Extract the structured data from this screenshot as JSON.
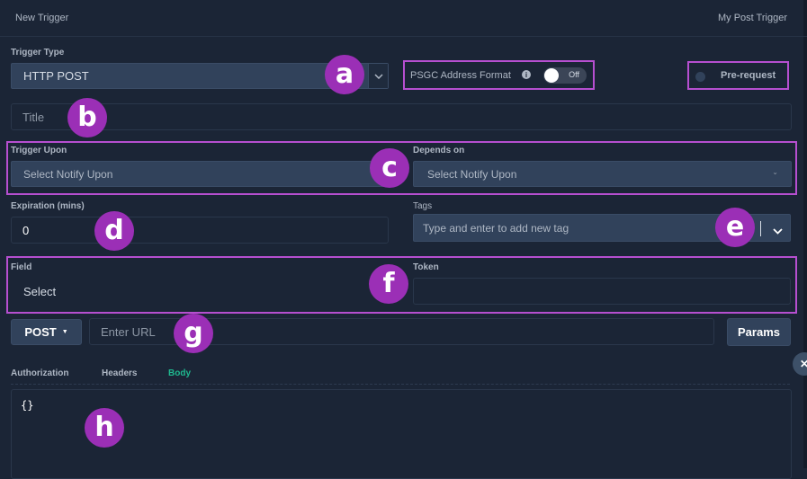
{
  "header": {
    "left": "New Trigger",
    "right": "My Post Trigger"
  },
  "trigger_type": {
    "label": "Trigger Type",
    "value": "HTTP POST"
  },
  "psgc": {
    "label": "PSGC Address Format",
    "toggle_text": "Off"
  },
  "prerequest": {
    "label": "Pre-request"
  },
  "title": {
    "placeholder": "Title"
  },
  "trigger_upon": {
    "label": "Trigger Upon",
    "placeholder": "Select Notify Upon"
  },
  "depends_on": {
    "label": "Depends on",
    "placeholder": "Select Notify Upon"
  },
  "expiration": {
    "label": "Expiration (mins)",
    "value": "0"
  },
  "tags": {
    "label": "Tags",
    "placeholder": "Type and enter to add new tag"
  },
  "field": {
    "label": "Field",
    "value": "Select"
  },
  "token": {
    "label": "Token"
  },
  "request": {
    "method": "POST",
    "url_placeholder": "Enter URL",
    "params_label": "Params"
  },
  "tabs": [
    "Authorization",
    "Headers",
    "Body"
  ],
  "body": {
    "content": "{}"
  },
  "badges": [
    "a",
    "b",
    "c",
    "d",
    "e",
    "f",
    "g",
    "h"
  ],
  "colors": {
    "background": "#1b2536",
    "highlight": "#b64fd0",
    "badge": "#9b2fb6",
    "active_tab": "#1fb88f"
  }
}
